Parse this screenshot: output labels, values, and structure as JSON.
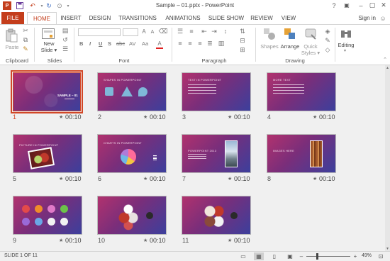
{
  "window": {
    "title": "Sample – 01.pptx - PowerPoint",
    "help": "?",
    "minimize": "–",
    "restore": "▢",
    "close": "✕"
  },
  "quick_access": {
    "save_icon": "save-icon",
    "undo_icon": "undo-icon",
    "redo_icon": "redo-icon"
  },
  "tabs": [
    "FILE",
    "HOME",
    "INSERT",
    "DESIGN",
    "TRANSITIONS",
    "ANIMATIONS",
    "SLIDE SHOW",
    "REVIEW",
    "VIEW"
  ],
  "active_tab": "HOME",
  "signin": "Sign in",
  "ribbon": {
    "clipboard": {
      "paste": "Paste",
      "label": "Clipboard"
    },
    "slides": {
      "new_slide_1": "New",
      "new_slide_2": "Slide ▾",
      "label": "Slides"
    },
    "font": {
      "bold": "B",
      "italic": "I",
      "underline": "U",
      "shadow": "S",
      "strike": "abc",
      "spacing": "AV",
      "case": "Aa",
      "label": "Font"
    },
    "paragraph": {
      "label": "Paragraph"
    },
    "drawing": {
      "shapes": "Shapes",
      "arrange": "Arrange",
      "quick_1": "Quick",
      "quick_2": "Styles ▾",
      "label": "Drawing"
    },
    "editing": {
      "label": "Editing"
    }
  },
  "slides": [
    {
      "num": "1",
      "title": "SAMPLE – 01",
      "duration": "00:10",
      "selected": true
    },
    {
      "num": "2",
      "title": "SHAPES IN POWERPOINT",
      "duration": "00:10"
    },
    {
      "num": "3",
      "title": "TEXT IN POWERPOINT",
      "duration": "00:10"
    },
    {
      "num": "4",
      "title": "MORE TEXT",
      "duration": "00:10"
    },
    {
      "num": "5",
      "title": "PICTURE IN POWERPOINT",
      "duration": "00:10"
    },
    {
      "num": "6",
      "title": "CHARTS IN POWERPOINT",
      "duration": "00:10"
    },
    {
      "num": "7",
      "title": "POWERPOINT 2013",
      "duration": "00:10"
    },
    {
      "num": "8",
      "title": "IMAGES HERE",
      "duration": "00:10"
    },
    {
      "num": "9",
      "title": "",
      "duration": "00:10"
    },
    {
      "num": "10",
      "title": "",
      "duration": "00:10"
    },
    {
      "num": "11",
      "title": "",
      "duration": "00:10"
    }
  ],
  "status": {
    "slide_info": "SLIDE 1 OF 11",
    "zoom": "49%",
    "zoom_level": 0.49
  },
  "colors": {
    "accent": "#c43e1c",
    "selection": "#d24726"
  }
}
